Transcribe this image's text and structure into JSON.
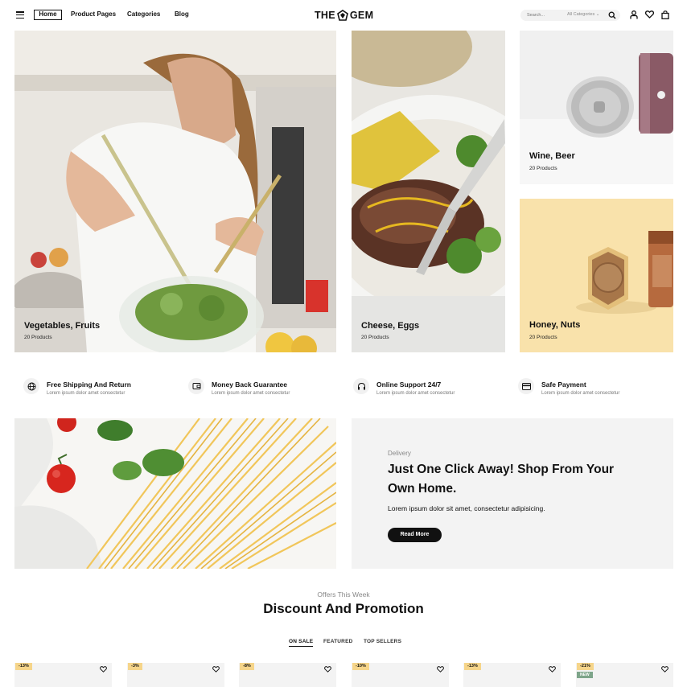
{
  "header": {
    "nav": [
      "Home",
      "Product Pages",
      "Categories",
      "Blog"
    ],
    "logo_left": "THE",
    "logo_right": "GEM",
    "search_placeholder": "Search...",
    "search_category": "All Categories"
  },
  "categories": [
    {
      "title": "Vegetables, Fruits",
      "count": "20 Products"
    },
    {
      "title": "Cheese, Eggs",
      "count": "20 Products"
    },
    {
      "title": "Wine, Beer",
      "count": "20 Products"
    },
    {
      "title": "Honey, Nuts",
      "count": "20 Products"
    }
  ],
  "features": [
    {
      "icon": "globe-icon",
      "title": "Free Shipping And Return",
      "text": "Lorem ipsum dolor amet consectetur"
    },
    {
      "icon": "wallet-icon",
      "title": "Money Back Guarantee",
      "text": "Lorem ipsum dolor amet consectetur"
    },
    {
      "icon": "headphones-icon",
      "title": "Online Support 24/7",
      "text": "Lorem ipsum dolor amet consectetur"
    },
    {
      "icon": "credit-card-icon",
      "title": "Safe Payment",
      "text": "Lorem ipsum dolor amet consectetur"
    }
  ],
  "promo": {
    "label": "Delivery",
    "heading": "Just One Click Away! Shop From Your Own Home.",
    "text": "Lorem ipsum dolor sit amet, consectetur adipisicing.",
    "button": "Read More"
  },
  "offers": {
    "subtitle": "Offers This Week",
    "title": "Discount And Promotion",
    "tabs": [
      "ON SALE",
      "FEATURED",
      "TOP SELLERS"
    ],
    "active_tab": "ON SALE"
  },
  "products": [
    {
      "badge": "-13%"
    },
    {
      "badge": "-3%"
    },
    {
      "badge": "-8%"
    },
    {
      "badge": "-10%"
    },
    {
      "badge": "-13%"
    },
    {
      "badge": "-21%",
      "new": "NEW"
    }
  ],
  "colors": {
    "accent_dark": "#111111",
    "badge_sale": "#f6d58a",
    "badge_new": "#7ea58a",
    "tile_honey_bg": "#f9e2ab",
    "panel_gray": "#f3f3f3"
  }
}
